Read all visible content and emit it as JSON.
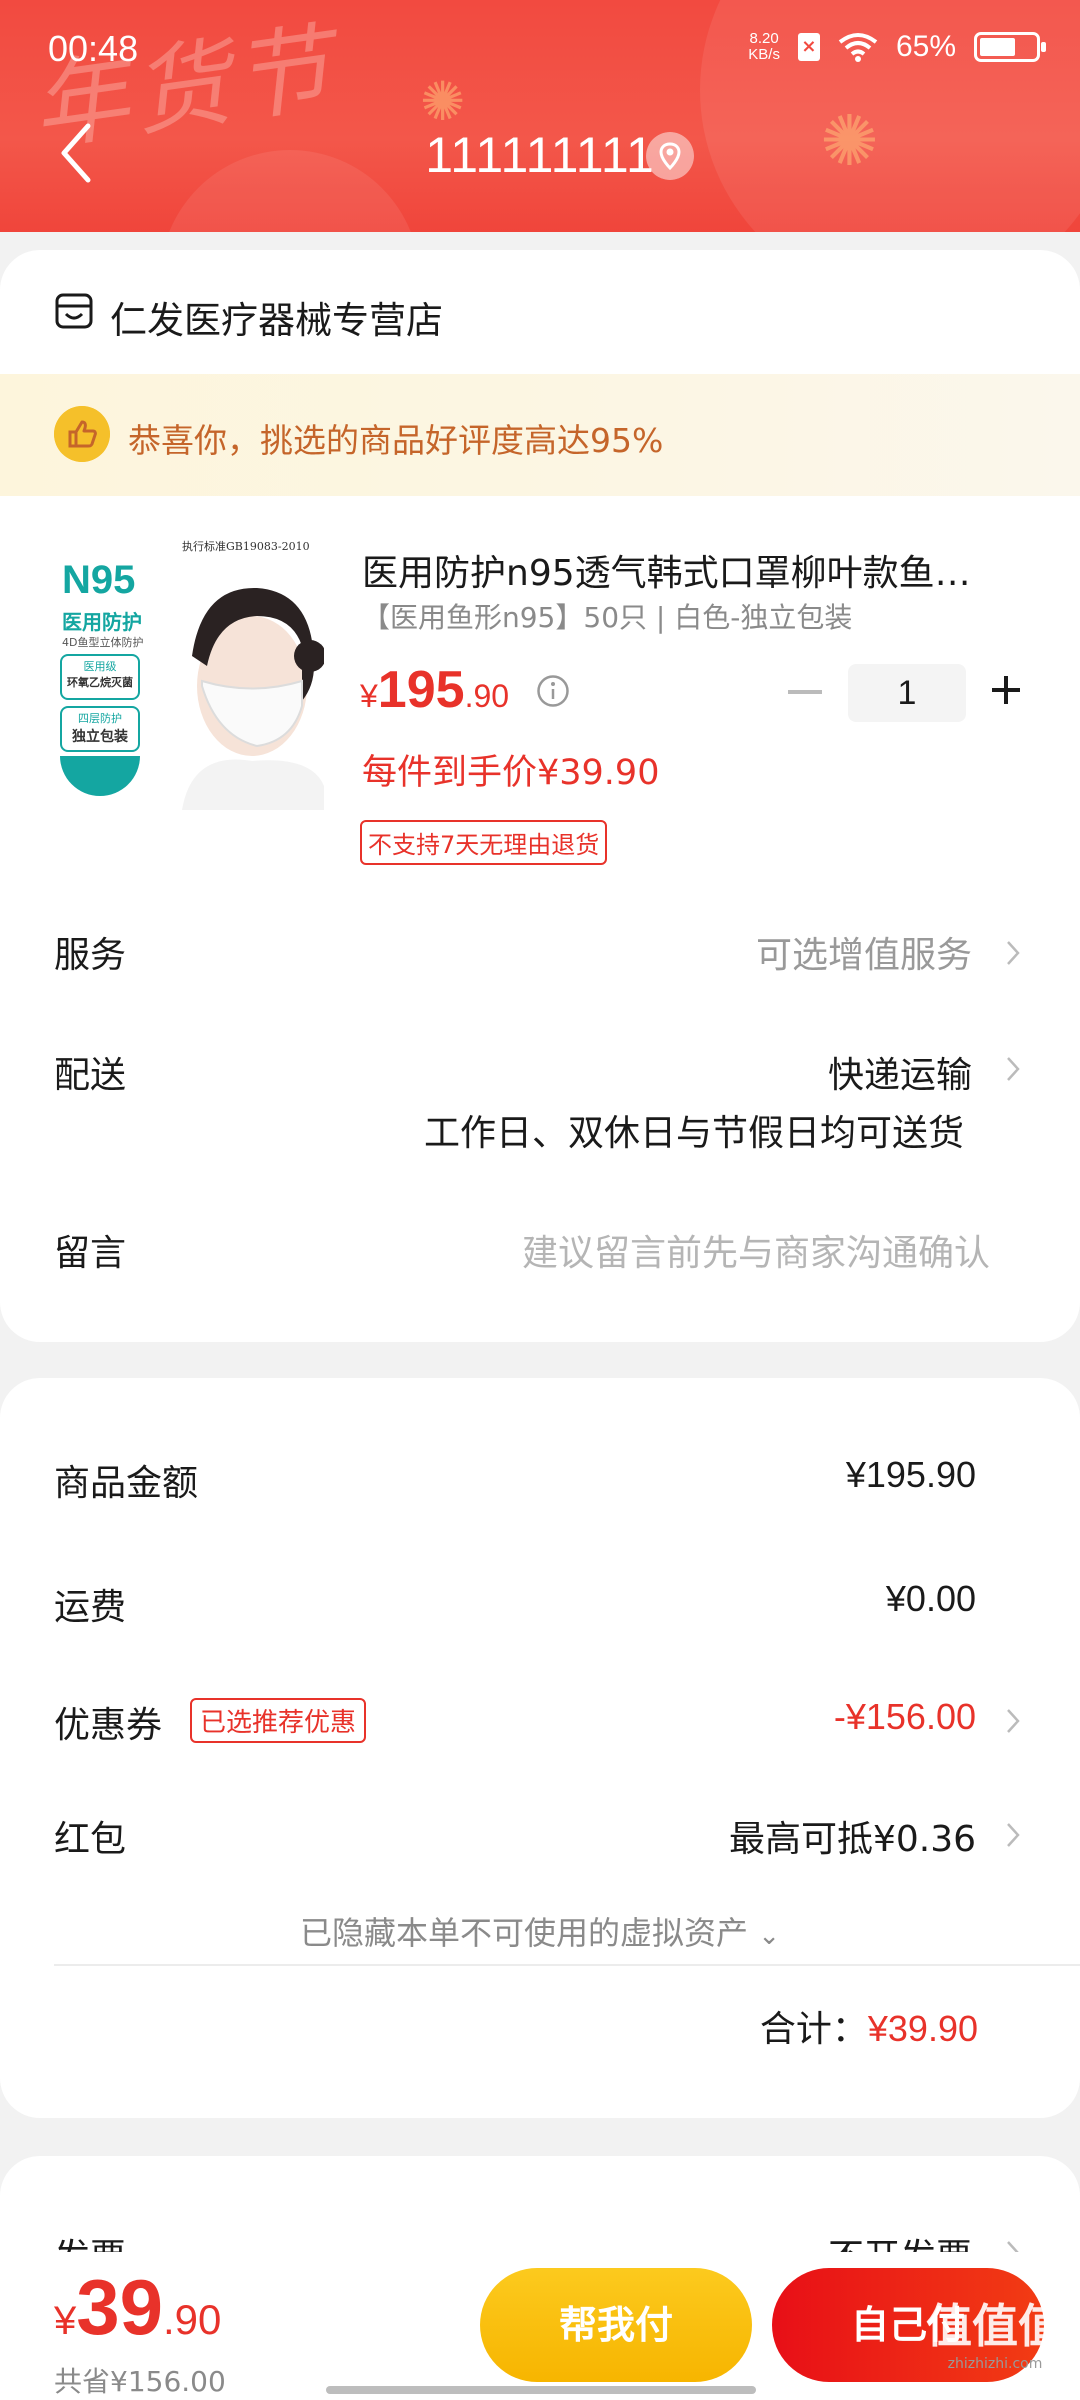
{
  "status_bar": {
    "time": "00:48",
    "net_speed_value": "8.20",
    "net_speed_unit": "KB/s",
    "battery_percent": "65%",
    "battery_level": 0.65
  },
  "header": {
    "decoration_text": "年货节",
    "title": "111111111"
  },
  "shop": {
    "name": "仁发医疗器械专营店"
  },
  "promo": {
    "text": "恭喜你，挑选的商品好评度高达95%"
  },
  "product": {
    "image_text": {
      "standard": "执行标准GB19083-2010",
      "brand": "N95",
      "subtitle": "医用防护",
      "tagline": "4D鱼型立体防护",
      "badge1_line1": "医用级",
      "badge1_line2": "环氧乙烷灭菌",
      "badge2_line1": "四层防护",
      "badge2_line2": "独立包装"
    },
    "title": "医用防护n95透气韩式口罩柳叶款鱼…",
    "spec": "【医用鱼形n95】50只 | 白色-独立包装",
    "price_symbol": "¥",
    "price_int": "195",
    "price_dec": ".90",
    "quantity": "1",
    "unit_price": "每件到手价¥39.90",
    "no_return": "不支持7天无理由退货"
  },
  "service": {
    "label": "服务",
    "value": "可选增值服务"
  },
  "delivery": {
    "label": "配送",
    "value": "快递运输",
    "sub": "工作日、双休日与节假日均可送货"
  },
  "message": {
    "label": "留言",
    "placeholder": "建议留言前先与商家沟通确认"
  },
  "summary": {
    "goods_label": "商品金额",
    "goods_value": "¥195.90",
    "shipping_label": "运费",
    "shipping_value": "¥0.00",
    "coupon_label": "优惠券",
    "coupon_tag": "已选推荐优惠",
    "coupon_value": "-¥156.00",
    "redpacket_label": "红包",
    "redpacket_value": "最高可抵¥0.36",
    "hidden_assets": "已隐藏本单不可使用的虚拟资产",
    "total_label": "合计：",
    "total_value": "¥39.90"
  },
  "invoice": {
    "label": "发票",
    "value": "不开发票"
  },
  "bottom": {
    "price_symbol": "¥",
    "price_int": "39",
    "price_dec": ".90",
    "saved": "共省¥156.00",
    "help_pay": "帮我付",
    "self_pay": "自己付"
  },
  "watermark": {
    "main": "值值值",
    "sub": "zhizhizhi.com"
  },
  "colors": {
    "accent_red": "#e8322a",
    "header_red": "#f24a40",
    "help_yellow": "#f7b500"
  }
}
